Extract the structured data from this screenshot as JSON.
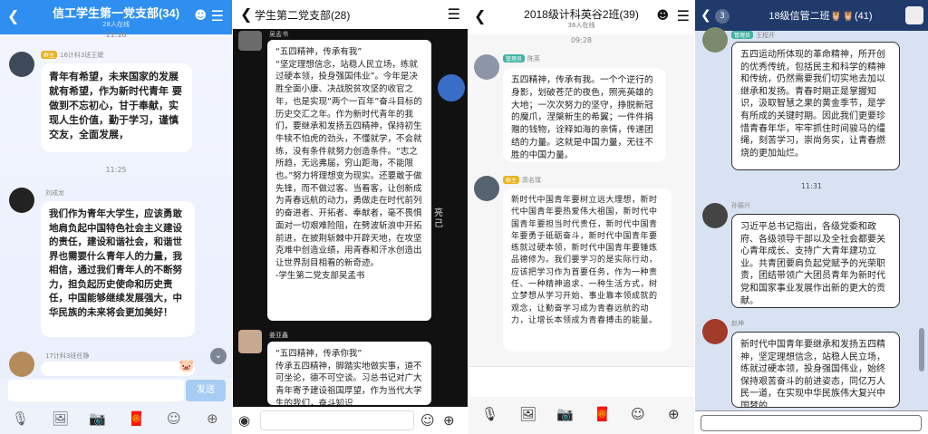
{
  "p1": {
    "title": "信工学生第一党支部(34)",
    "online": "28人在线",
    "time1": "11:16",
    "name1": "16计科3班王婕",
    "tag1": "群主",
    "msg1": "青年有希望，未来国家的发展就有希望，作为新时代青年 要做到不忘初心，甘于奉献，实现人生价值，勤于学习，谨慎交友，全面发展，",
    "time2": "11:25",
    "name2": "刘成龙",
    "msg2": "我们作为青年大学生，应该勇敢地肩负起中国特色社会主义建设的责任，建设和谐社会，和谐世界也需要什么青年人的力量，我相信，通过我们青年人的不断努力，担负起历史使命和历史责任，中国能够继续发展强大，中华民族的未来将会更加美好！",
    "name3": "17计科3班任静",
    "send": "发送"
  },
  "p2": {
    "title": "学生第二党支部(28)",
    "name1": "吴孟书",
    "msg1": "“五四精神，传承有我”\n“坚定理想信念，站稳人民立场，练就过硬本领，投身强国伟业”。今年是决胜全面小康、决战脱贫攻坚的收官之年，也是实现“两个一百年”奋斗目标的历史交汇之年。作为新时代青年的我们，要继承和发扬五四精神，保持初生牛犊不怕虎的劲头，不懂就学，不会就练，没有条件就努力创造条件。“志之所趋，无远弗届，穷山距海，不能限也。”努力将理想变为现实。还要敢于做先锋，而不做过客、当看客，让创新成为青春远航的动力，勇做走在时代前列的奋进者、开拓者、奉献者，毫不畏惧面对一切艰难险阻，在劈波斩浪中开拓前进，在披荆斩棘中开辟天地，在攻坚克难中创造业绩，用青春和汗水创造出让世界刮目相看的新奇迹。\n-学生第二党支部吴孟书",
    "side": "亮己",
    "name2": "姜亚鑫",
    "msg2": "“五四精神，传承你我”\n传承五四精神，脚踏实地做实事，道不可坐论，德不可空谈。习总书记对广大青年寄予建设祖国厚望，作为当代大学生的我们，奋斗知识"
  },
  "p3": {
    "title": "2018级计科英谷2班(39)",
    "online": "36人在线",
    "time1": "09:28",
    "name1": "陈英",
    "tag1": "管理员",
    "msg1": "五四精神，传承有我。一个个逆行的身影，划破苍茫的夜色，照亮英雄的大地；一次次努力的坚守，挣脱新冠的魔爪，涅槃新生的希翼；一件件捐赠的钱物，诠释如海的亲情，传递团结的力量。这就是中国力量，无往不胜的中国力量。",
    "name2": "高名璞",
    "tag2": "群主",
    "msg2": "新时代中国青年要树立远大理想，新时代中国青年要热爱伟大祖国，新时代中国青年要担当时代责任，新时代中国青年要勇于砥砺奋斗，新时代中国青年要练就过硬本领，新时代中国青年要锤炼品德修为。我们要学习的是实际行动，应该把学习作为首要任务，作为一种责任、一种精神追求、一种生活方式，树立梦想从学习开始、事业靠本领成就的观念，让勤奋学习成为青春远航的动力，让增长本领成为青春搏击的能量。"
  },
  "p4": {
    "title": "18级信管二班🦉🦉(41)",
    "badge": "3",
    "msg0": "五四运动所体现的革命精神，所开创的优秀传统，包括民主和科学的精神和传统，仍然需要我们切实地去加以继承和发扬。青春时期正是掌握知识，汲取智慧之果的黄金季节，是学有所成的关键时期。因此我们更要珍惜青春年华，牢牢抓住时间骏马的缰绳，刻苦学习，崇尚务实，让青春燃烧的更加灿烂。",
    "name0": "王程开",
    "tag0": "管理员",
    "time1": "11:31",
    "name1": "孙振兴",
    "msg1": "习近平总书记指出，各级党委和政府、各级领导干部以及全社会都要关心青年成长、支持广大青年建功立业。共青团要肩负起党赋予的光荣职责，团结带领广大团员青年为新时代党和国家事业发展作出新的更大的贡献。",
    "name2": "赵坤",
    "msg2": "新时代中国青年要继承和发扬五四精神，坚定理想信念，站稳人民立场，练就过硬本领，投身强国伟业，始终保持艰苦奋斗的前进姿态，同亿万人民一道，在实现中华民族伟大复兴中国梦的"
  },
  "colors": {
    "qq_blue": "#2f8ff0",
    "navy": "#1f3a6b"
  }
}
